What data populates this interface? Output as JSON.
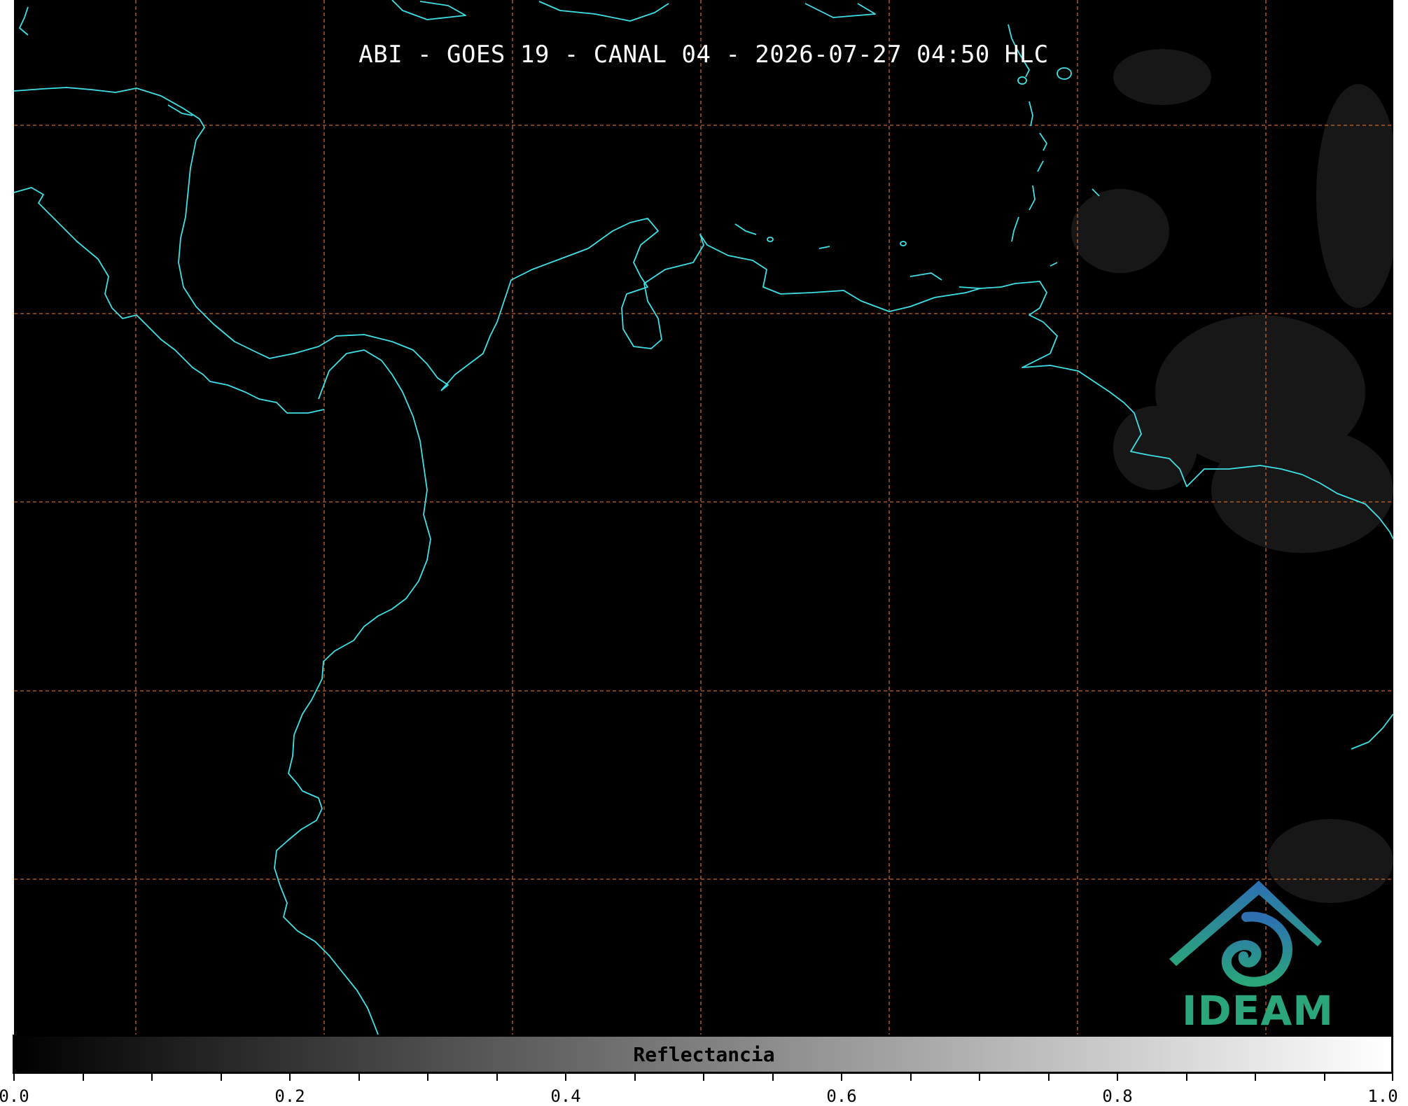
{
  "title": "ABI - GOES 19 - CANAL 04 - 2026-07-27 04:50 HLC",
  "colorbar": {
    "label": "Reflectancia",
    "ticks": [
      "0.0",
      "0.2",
      "0.4",
      "0.6",
      "0.8",
      "1.0"
    ],
    "range": [
      0.0,
      1.0
    ],
    "colormap": "grayscale"
  },
  "logo": {
    "text": "IDEAM"
  },
  "colors": {
    "background": "#000000",
    "coastline": "#3fe0e6",
    "grid": "#c8672a",
    "logo_green": "#2aa67a",
    "logo_blue": "#2d6fb3"
  }
}
